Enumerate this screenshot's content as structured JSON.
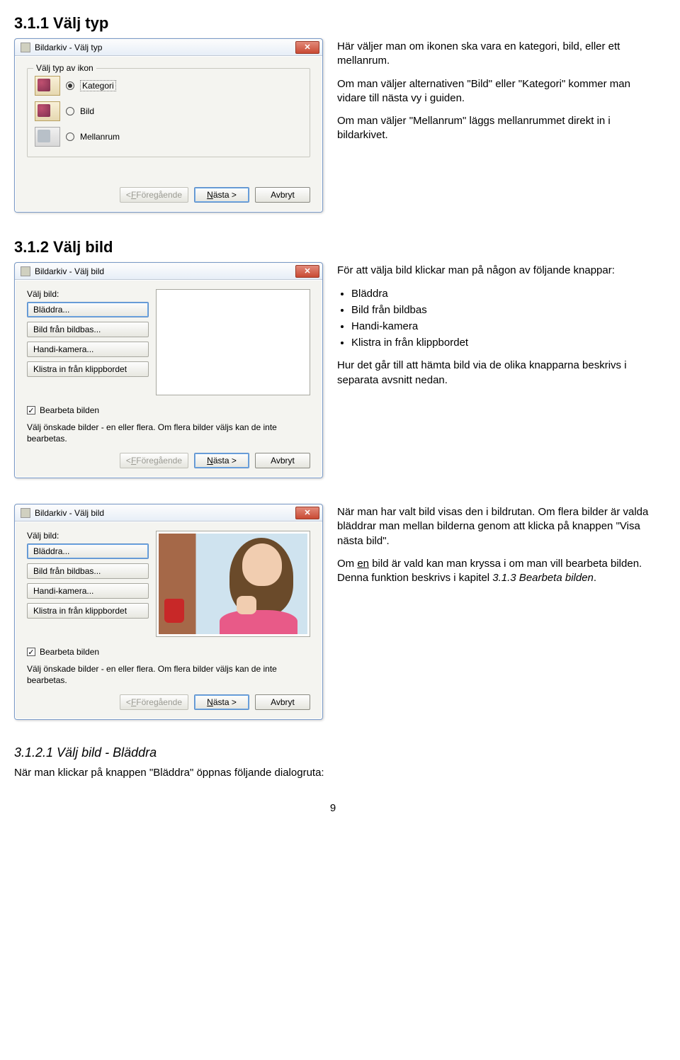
{
  "sections": {
    "s1": {
      "heading": "3.1.1 Välj typ",
      "p1": "Här väljer man om ikonen ska vara en kategori, bild, eller ett mellanrum.",
      "p2": "Om man väljer alternativen \"Bild\" eller \"Kategori\" kommer man vidare till nästa vy i guiden.",
      "p3": "Om man väljer \"Mellanrum\" läggs mellanrummet direkt in i bildarkivet."
    },
    "s2": {
      "heading": "3.1.2 Välj bild",
      "intro": "För att välja bild klickar man på någon av följande knappar:",
      "bullets": [
        "Bläddra",
        "Bild från bildbas",
        "Handi-kamera",
        "Klistra in från klippbordet"
      ],
      "p_after": "Hur det går till att hämta bild via de olika knapparna beskrivs i separata avsnitt nedan."
    },
    "s2b": {
      "p1": "När man har valt bild visas den i bildrutan. Om flera bilder är valda bläddrar man mellan bilderna genom att klicka på knappen \"Visa nästa bild\".",
      "p2a": "Om ",
      "p2u": "en",
      "p2b": " bild är vald kan man kryssa i om man vill bearbeta bilden. Denna funktion beskrivs i kapitel ",
      "p2i": "3.1.3 Bearbeta bilden",
      "p2c": "."
    },
    "s3": {
      "heading": "3.1.2.1 Välj bild - Bläddra",
      "p1": "När man klickar på knappen \"Bläddra\" öppnas följande dialogruta:"
    }
  },
  "dialog1": {
    "title": "Bildarkiv - Välj typ",
    "group": "Välj typ av ikon",
    "options": {
      "kategori": "Kategori",
      "bild": "Bild",
      "mellanrum": "Mellanrum"
    },
    "buttons": {
      "prev_label": "Föregående",
      "prev_u": "F",
      "next_label": "ästa >",
      "next_u": "N",
      "cancel": "Avbryt"
    },
    "prev_prefix": "< "
  },
  "dialog2": {
    "title": "Bildarkiv - Välj bild",
    "label": "Välj bild:",
    "btns": {
      "browse": "Bläddra...",
      "bildbas": "Bild från bildbas...",
      "kamera": "Handi-kamera...",
      "clip": "Klistra in från klippbordet"
    },
    "chk_label": "Bearbeta bilden",
    "help": "Välj önskade bilder - en eller flera. Om flera bilder väljs kan de inte bearbetas.",
    "buttons": {
      "prev_label": "Föregående",
      "prev_u": "F",
      "next_label": "ästa >",
      "next_u": "N",
      "cancel": "Avbryt"
    },
    "prev_prefix": "< "
  },
  "page_num": "9"
}
